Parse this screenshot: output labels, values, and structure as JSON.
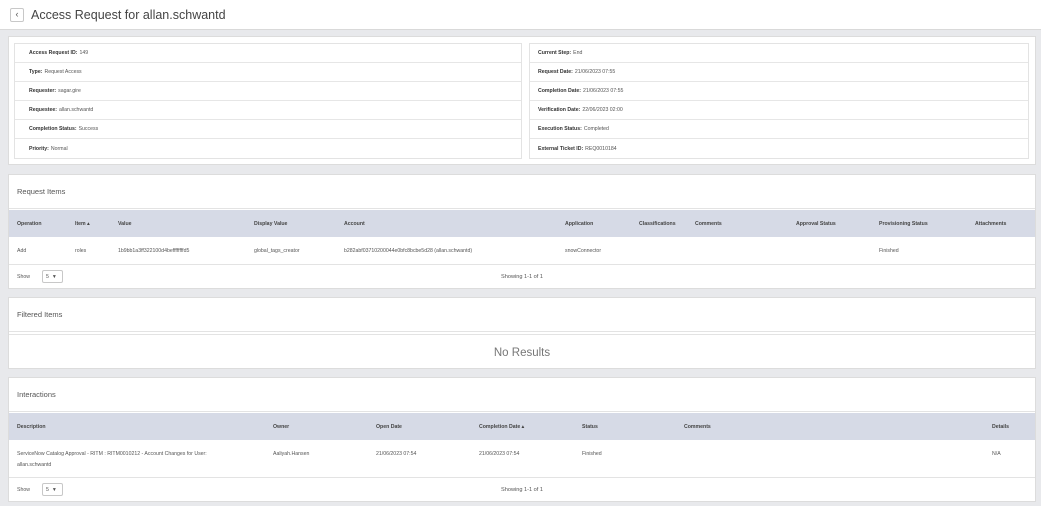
{
  "page": {
    "title": "Access Request for allan.schwantd",
    "back_icon": "‹"
  },
  "details": {
    "left": [
      {
        "label": "Access Request ID:",
        "value": "149"
      },
      {
        "label": "Type:",
        "value": "Request Access"
      },
      {
        "label": "Requester:",
        "value": "sagar.gire"
      },
      {
        "label": "Requestee:",
        "value": "allan.schwantd"
      },
      {
        "label": "Completion Status:",
        "value": "Success"
      },
      {
        "label": "Priority:",
        "value": "Normal"
      }
    ],
    "right": [
      {
        "label": "Current Step:",
        "value": "End"
      },
      {
        "label": "Request Date:",
        "value": "21/06/2023 07:55"
      },
      {
        "label": "Completion Date:",
        "value": "21/06/2023 07:55"
      },
      {
        "label": "Verification Date:",
        "value": "22/06/2023 02:00"
      },
      {
        "label": "Execution Status:",
        "value": "Completed"
      },
      {
        "label": "External Ticket ID:",
        "value": "REQ0010184"
      }
    ]
  },
  "request_items": {
    "title": "Request Items",
    "columns": [
      "Operation",
      "Item ▴",
      "Value",
      "Display Value",
      "Account",
      "Application",
      "Classifications",
      "Comments",
      "Approval Status",
      "Provisioning Status",
      "Attachments"
    ],
    "rows": [
      {
        "operation": "Add",
        "item": "roles",
        "value": "1b9bb1a3ff322100d4beffffffffd5",
        "display_value": "global_tags_creator",
        "account": "b282abf03710200044e0bfc8bcbe5d28 (allan.schwantd)",
        "application": "snowConnector",
        "classifications": "",
        "comments": "",
        "approval_status": "",
        "provisioning_status": "Finished",
        "attachments": ""
      }
    ],
    "show_label": "Show",
    "page_size": "5",
    "showing": "Showing 1-1 of 1"
  },
  "filtered_items": {
    "title": "Filtered Items",
    "no_results": "No Results"
  },
  "interactions": {
    "title": "Interactions",
    "columns": [
      "Description",
      "Owner",
      "Open Date",
      "Completion Date ▴",
      "Status",
      "Comments",
      "Details"
    ],
    "rows": [
      {
        "description_line1": "ServiceNow Catalog Approval - RITM : RITM0010212 - Account Changes for User:",
        "description_line2": "allan.schwantd",
        "owner": "Aaliyah.Hansen",
        "open_date": "21/06/2023 07:54",
        "completion_date": "21/06/2023 07:54",
        "status": "Finished",
        "comments": "",
        "details": "N/A"
      }
    ],
    "show_label": "Show",
    "page_size": "5",
    "showing": "Showing 1-1 of 1"
  }
}
